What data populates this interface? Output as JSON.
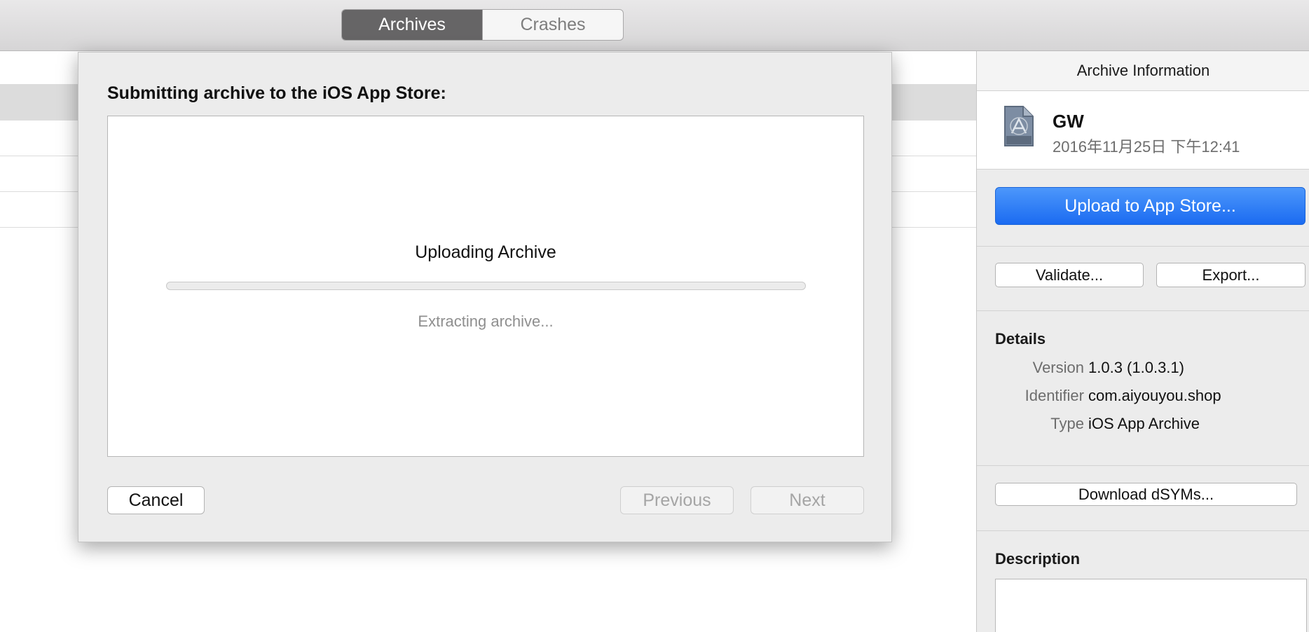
{
  "toolbar": {
    "tabs": [
      {
        "label": "Archives",
        "active": true
      },
      {
        "label": "Crashes",
        "active": false
      }
    ]
  },
  "sheet": {
    "title": "Submitting archive to the iOS App Store:",
    "upload_title": "Uploading Archive",
    "progress_percent": 0,
    "status": "Extracting archive...",
    "cancel_label": "Cancel",
    "previous_label": "Previous",
    "next_label": "Next"
  },
  "inspector": {
    "header": "Archive Information",
    "app": {
      "name": "GW",
      "date": "2016年11月25日 下午12:41",
      "icon": "app-archive-icon"
    },
    "upload_label": "Upload to App Store...",
    "validate_label": "Validate...",
    "export_label": "Export...",
    "details_title": "Details",
    "details": [
      {
        "label": "Version",
        "value": "1.0.3 (1.0.3.1)"
      },
      {
        "label": "Identifier",
        "value": "com.aiyouyou.shop"
      },
      {
        "label": "Type",
        "value": "iOS App Archive"
      }
    ],
    "download_dsyms_label": "Download dSYMs...",
    "description_title": "Description",
    "description_value": ""
  },
  "colors": {
    "accent": "#1b6bf1",
    "segment_active": "#666566"
  }
}
